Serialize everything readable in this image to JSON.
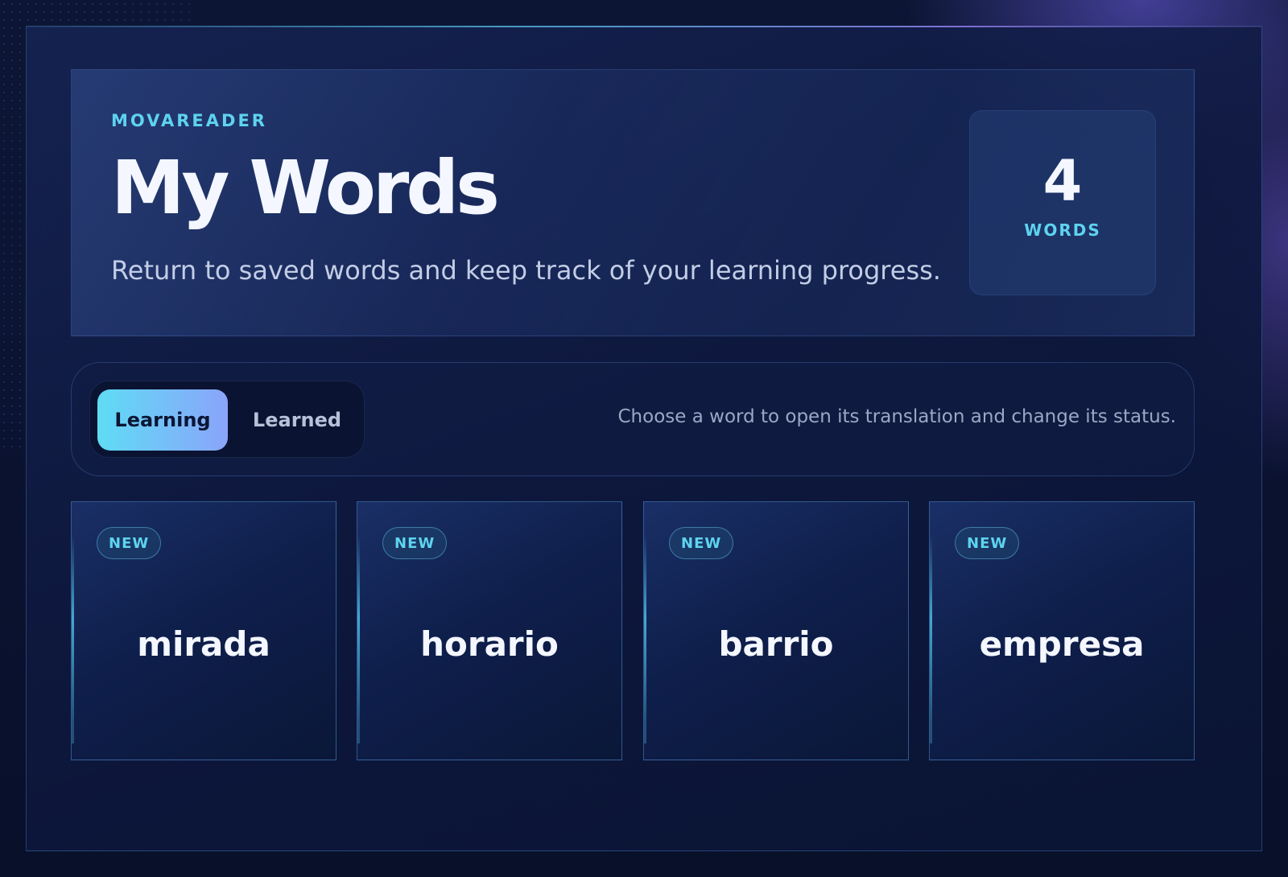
{
  "header": {
    "brand": "MOVAREADER",
    "title": "My Words",
    "subtitle": "Return to saved words and keep track of your learning progress.",
    "word_count": "4",
    "word_count_label": "WORDS"
  },
  "tabs": [
    {
      "label": "Learning",
      "active": true
    },
    {
      "label": "Learned",
      "active": false
    }
  ],
  "hint": "Choose a word to open its translation and change its status.",
  "cards": [
    {
      "badge": "NEW",
      "word": "mirada"
    },
    {
      "badge": "NEW",
      "word": "horario"
    },
    {
      "badge": "NEW",
      "word": "barrio"
    },
    {
      "badge": "NEW",
      "word": "empresa"
    }
  ],
  "colors": {
    "accent": "#5ed3ef",
    "tab_gradient_start": "#5fdcf4",
    "tab_gradient_end": "#8aa4fb",
    "background": "#0c1634"
  }
}
